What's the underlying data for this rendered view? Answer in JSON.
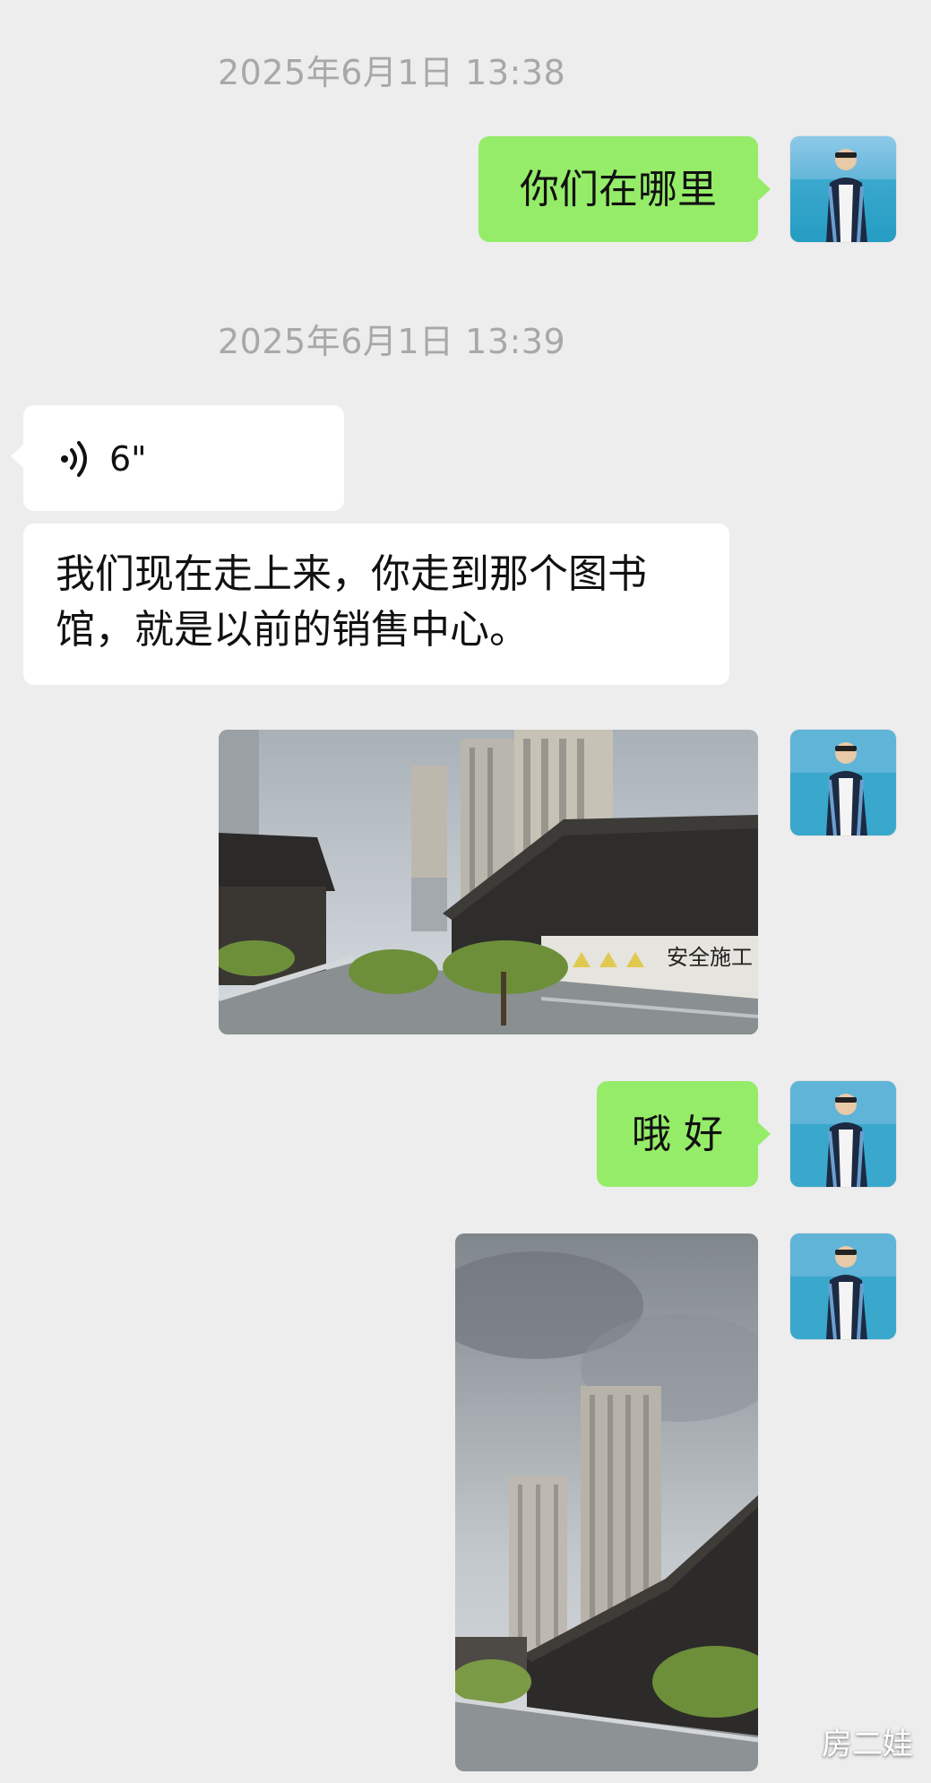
{
  "messages": {
    "timestamp_1": "2025年6月1日 13:38",
    "msg_1": "你们在哪里",
    "timestamp_2": "2025年6月1日 13:39",
    "voice_duration": "6\"",
    "msg_2": "我们现在走上来，你走到那个图书馆，就是以前的销售中心。",
    "photo_1_sign": "安全施工",
    "msg_3": "哦 好"
  },
  "watermark": "房二娃",
  "colors": {
    "background": "#ededed",
    "sent_bubble": "#95ec69",
    "received_bubble": "#ffffff",
    "timestamp": "#a8a8a8"
  },
  "icons": [
    "voice-wave-icon"
  ]
}
